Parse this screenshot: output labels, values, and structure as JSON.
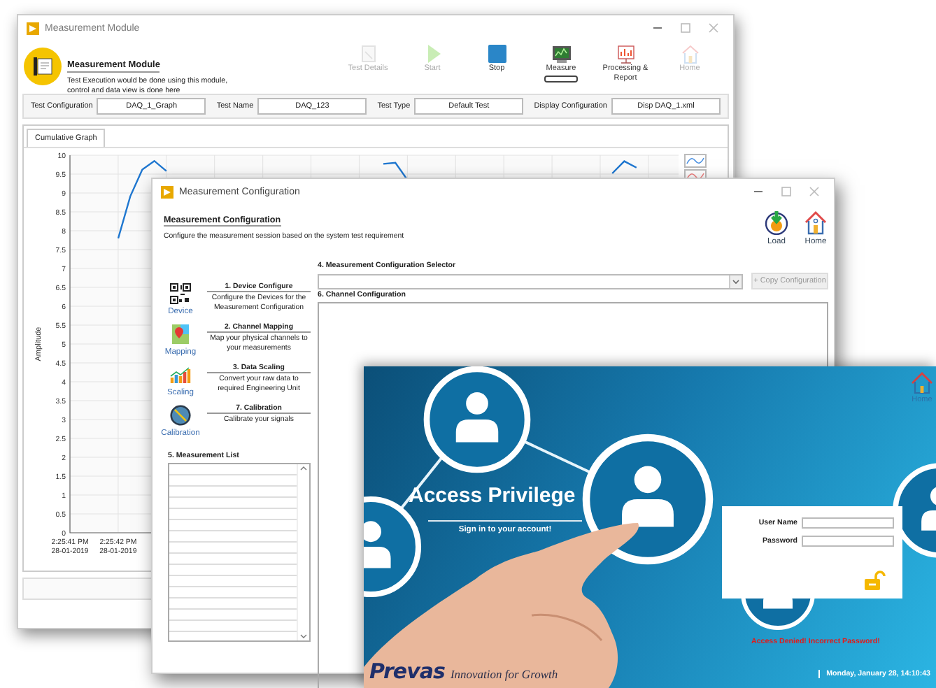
{
  "measurement_module": {
    "window": {
      "title": "Measurement Module"
    },
    "header": {
      "title": "Measurement Module",
      "description": "Test Execution would be done using this module, control and data view is done here"
    },
    "toolbar": [
      {
        "kind": "details",
        "label": "Test Details",
        "disabled": true,
        "selected": false
      },
      {
        "kind": "start",
        "label": "Start",
        "disabled": true,
        "selected": false
      },
      {
        "kind": "stop",
        "label": "Stop",
        "disabled": false,
        "selected": false
      },
      {
        "kind": "measure",
        "label": "Measure",
        "disabled": false,
        "selected": true
      },
      {
        "kind": "report",
        "label": "Processing & Report",
        "disabled": false,
        "selected": false
      },
      {
        "kind": "home",
        "label": "Home",
        "disabled": true,
        "selected": false
      }
    ],
    "fields": [
      {
        "label": "Test Configuration",
        "value": "DAQ_1_Graph"
      },
      {
        "label": "Test Name",
        "value": "DAQ_123"
      },
      {
        "label": "Test Type",
        "value": "Default Test"
      },
      {
        "label": "Display Configuration",
        "value": "Disp DAQ_1.xml"
      }
    ],
    "tabs": [
      {
        "label": "Cumulative Graph",
        "selected": true
      }
    ],
    "chart_data": {
      "type": "line",
      "grid": true,
      "ylabel": "Amplitude",
      "ylim": [
        0,
        10
      ],
      "yticks": [
        0,
        {
          "value": 0.5,
          "label": "0.5"
        },
        1,
        {
          "value": 1.5,
          "label": "1.5"
        },
        2,
        {
          "value": 2.5,
          "label": "2.5"
        },
        3,
        {
          "value": 3.5,
          "label": "3.5"
        },
        4,
        {
          "value": 4.5,
          "label": "4.5"
        },
        5,
        {
          "value": 5.5,
          "label": "5.5"
        },
        6,
        {
          "value": 6.5,
          "label": "6.5"
        },
        7,
        {
          "value": 7.5,
          "label": "7.5"
        },
        8,
        {
          "value": 8.5,
          "label": "8.5"
        },
        9,
        {
          "value": 9.5,
          "label": "9.5"
        },
        10
      ],
      "categories": [
        "2:25:41 PM 28-01-2019",
        null,
        null,
        null,
        "2:25:42 PM 28-01-2019",
        null,
        null,
        null,
        null,
        null,
        null,
        null,
        null,
        null,
        null,
        null,
        null,
        null,
        null,
        null,
        null,
        null,
        null,
        null,
        null,
        null,
        null,
        null,
        null,
        null,
        null,
        null,
        null,
        null,
        null,
        null,
        null,
        null,
        null,
        null,
        null,
        null,
        null,
        null,
        null,
        null,
        null,
        null,
        null,
        null,
        null
      ],
      "series": [
        {
          "color": "#1f77d0",
          "values": [
            null,
            null,
            null,
            null,
            7.8,
            8.91,
            9.62,
            9.85,
            9.58,
            null,
            null,
            null,
            null,
            null,
            null,
            null,
            null,
            null,
            null,
            null,
            null,
            null,
            null,
            null,
            null,
            null,
            9.77,
            9.8,
            9.35,
            null,
            null,
            null,
            null,
            null,
            null,
            null,
            null,
            null,
            null,
            null,
            null,
            null,
            null,
            null,
            null,
            9.52,
            9.84,
            9.67,
            null,
            null,
            null
          ]
        }
      ]
    }
  },
  "measurement_configuration": {
    "window": {
      "title": "Measurement Configuration"
    },
    "header": {
      "title": "Measurement Configuration",
      "description": "Configure the measurement session based on the system test requirement"
    },
    "actions": [
      {
        "kind": "load",
        "label": "Load"
      },
      {
        "kind": "home",
        "label": "Home"
      }
    ],
    "steps": [
      {
        "kind": "device",
        "label": "Device",
        "title": "1. Device Configure",
        "description": "Configure the Devices for the Measurement Configuration"
      },
      {
        "kind": "mapping",
        "label": "Mapping",
        "title": "2. Channel Mapping",
        "description": "Map your physical channels to your measurements"
      },
      {
        "kind": "scaling",
        "label": "Scaling",
        "title": "3. Data Scaling",
        "description": "Convert your raw data to required Engineering Unit"
      },
      {
        "kind": "calibration",
        "label": "Calibration",
        "title": "7. Calibration",
        "description": "Calibrate your signals"
      }
    ],
    "measurement_list": {
      "title": "5. Measurement List"
    },
    "selector": {
      "label": "4. Measurement Configuration Selector"
    },
    "copy_button": {
      "label": "+ Copy Configuration",
      "disabled": true
    },
    "channel_configuration": {
      "label": "6. Channel Configuration"
    }
  },
  "access_privilege": {
    "home_button": {
      "label": "Home"
    },
    "title": "Access Privilege",
    "subtitle": "Sign in to your account!",
    "fields": [
      {
        "label": "User Name"
      },
      {
        "label": "Password"
      }
    ],
    "error": "Access Denied! Incorrect Password!",
    "logo": {
      "name": "Prevas",
      "tagline": "Innovation for Growth"
    },
    "datetime": "Monday, January 28, 14:10:43"
  }
}
